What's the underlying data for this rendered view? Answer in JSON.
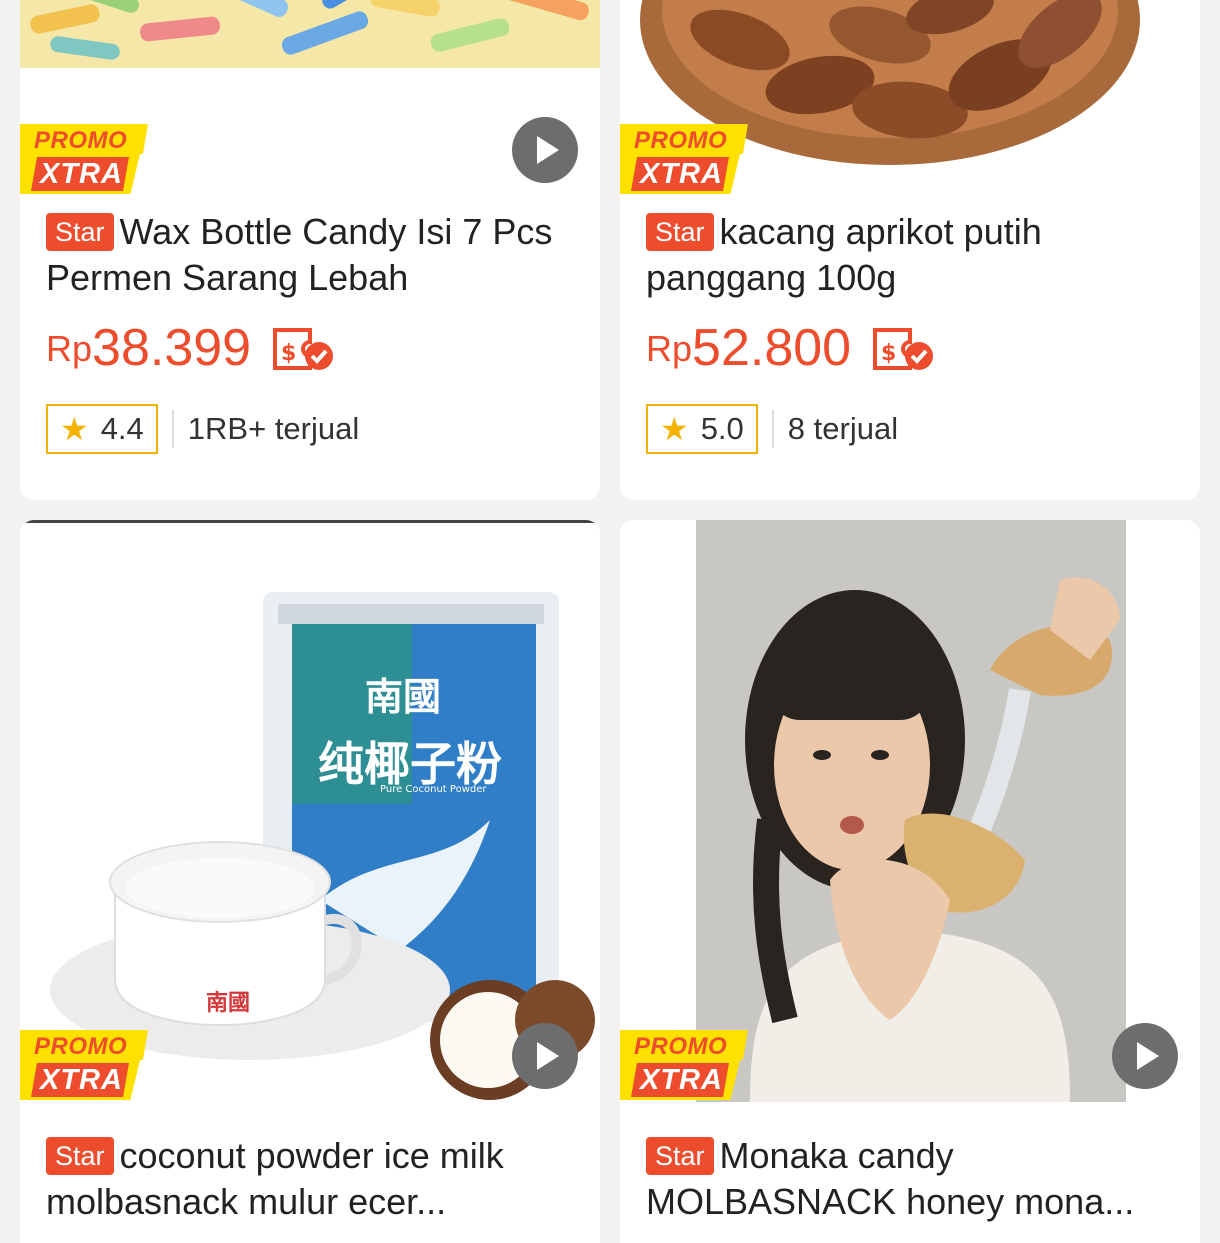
{
  "promo": {
    "line1": "PROMO",
    "line2": "XTRA"
  },
  "star_label": "Star",
  "currency": "Rp",
  "colors": {
    "accent": "#ee4d2d",
    "promo_yellow": "#ffe100",
    "rating_star": "#f5b301"
  },
  "products": [
    {
      "title": "Wax Bottle Candy Isi 7 Pcs Permen Sarang Lebah",
      "price": "38.399",
      "rating": "4.4",
      "sold": "1RB+ terjual"
    },
    {
      "title": "kacang aprikot putih panggang 100g",
      "price": "52.800",
      "rating": "5.0",
      "sold": "8 terjual"
    },
    {
      "title": "coconut powder ice milk molbasnack mulur ecer...",
      "image_text": {
        "brand": "南國",
        "name": "纯椰子粉",
        "sub": "Pure Coconut Powder"
      }
    },
    {
      "title": "Monaka candy MOLBASNACK honey mona..."
    }
  ]
}
